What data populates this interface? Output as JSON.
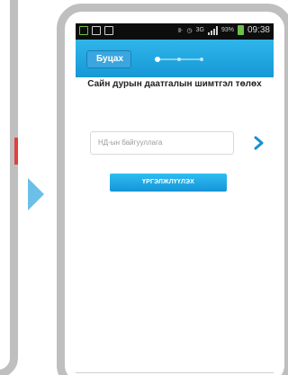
{
  "status_bar": {
    "battery_percent": "93%",
    "time": "09:38",
    "network": "3G"
  },
  "header": {
    "back_label": "Буцах",
    "progress": {
      "current_step": 1,
      "total_steps": 3
    }
  },
  "main": {
    "title": "Сайн дурын даатгалын шимтгэл төлөх",
    "input": {
      "placeholder": "НД-ын байгууллага",
      "value": ""
    },
    "submit_label": "ҮРГЭЛЖЛҮҮЛЭХ"
  },
  "colors": {
    "header_blue": "#1da6e0",
    "button_blue": "#1e9ee0",
    "frame_gray": "#bfbfbf",
    "arrow_blue": "#6cc0e8"
  }
}
